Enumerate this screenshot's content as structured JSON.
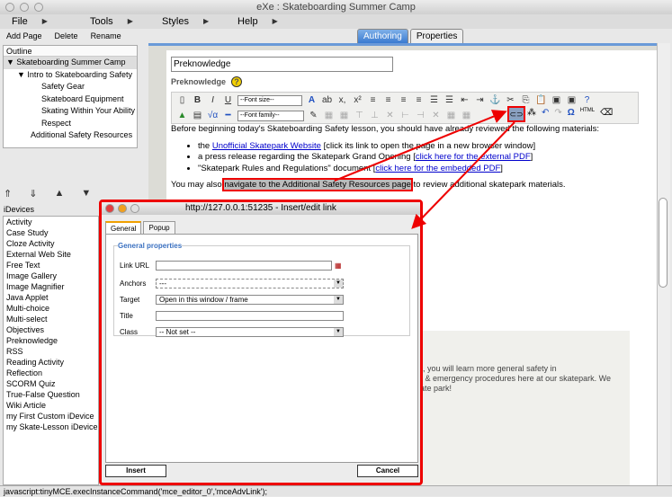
{
  "window": {
    "title": "eXe : Skateboarding Summer Camp"
  },
  "menu": [
    "File",
    "Tools",
    "Styles",
    "Help"
  ],
  "actions": [
    "Add Page",
    "Delete",
    "Rename"
  ],
  "outline": {
    "header": "Outline",
    "items": [
      "Skateboarding Summer Camp",
      "Intro to Skateboarding Safety",
      "Safety Gear",
      "Skateboard Equipment",
      "Skating Within Your Ability",
      "Respect",
      "Additional Safety Resources"
    ]
  },
  "idevices": {
    "header": "iDevices",
    "items": [
      "Activity",
      "Case Study",
      "Cloze Activity",
      "External Web Site",
      "Free Text",
      "Image Gallery",
      "Image Magnifier",
      "Java Applet",
      "Multi-choice",
      "Multi-select",
      "Objectives",
      "Preknowledge",
      "RSS",
      "Reading Activity",
      "Reflection",
      "SCORM Quiz",
      "True-False Question",
      "Wiki Article",
      "my First Custom iDevice",
      "my Skate-Lesson iDevice"
    ]
  },
  "tabs": [
    "Authoring",
    "Properties"
  ],
  "idevice_title": "Preknowledge",
  "idevice_label": "Preknowledge",
  "toolbar": {
    "font_size": "--Font size--",
    "font_family": "--Font family--"
  },
  "editor": {
    "intro": "Before beginning today's Skateboarding Safety lesson, you should have already reviewed the following materials:",
    "b1_pre": "the ",
    "b1_link": "Unofficial Skatepark Website",
    "b1_post": " [click its link to open the page in a new browser window]",
    "b2_pre": "a press release regarding the Skatepark Grand Opening [",
    "b2_link": "click here for the external PDF",
    "b2_post": "]",
    "b3_pre": "\"Skatepark Rules and Regulations\" document [",
    "b3_link": "click here for the embedded PDF",
    "b3_post": "]",
    "p2_pre": "You may also ",
    "p2_sel": "navigate to the Additional Safety Resources page",
    "p2_post": " to review additional skatepark materials."
  },
  "lower_text": [
    "ule, you will learn more general safety in",
    "ety & emergency procedures here at our skatepark. We",
    "skate park!"
  ],
  "dialog": {
    "title": "http://127.0.0.1:51235 - Insert/edit link",
    "tabs": [
      "General",
      "Popup"
    ],
    "legend": "General properties",
    "fields": {
      "link_url_label": "Link URL",
      "link_url": "",
      "anchors_label": "Anchors",
      "anchors": "---",
      "target_label": "Target",
      "target": "Open in this window / frame",
      "title_label": "Title",
      "title": "",
      "class_label": "Class",
      "class": "-- Not set --"
    },
    "insert": "Insert",
    "cancel": "Cancel"
  },
  "status": "javascript:tinyMCE.execInstanceCommand('mce_editor_0','mceAdvLink');",
  "colors": {
    "annotation": "#ee0000",
    "link": "#0000cc",
    "tab_active": "#3a7ad0"
  }
}
